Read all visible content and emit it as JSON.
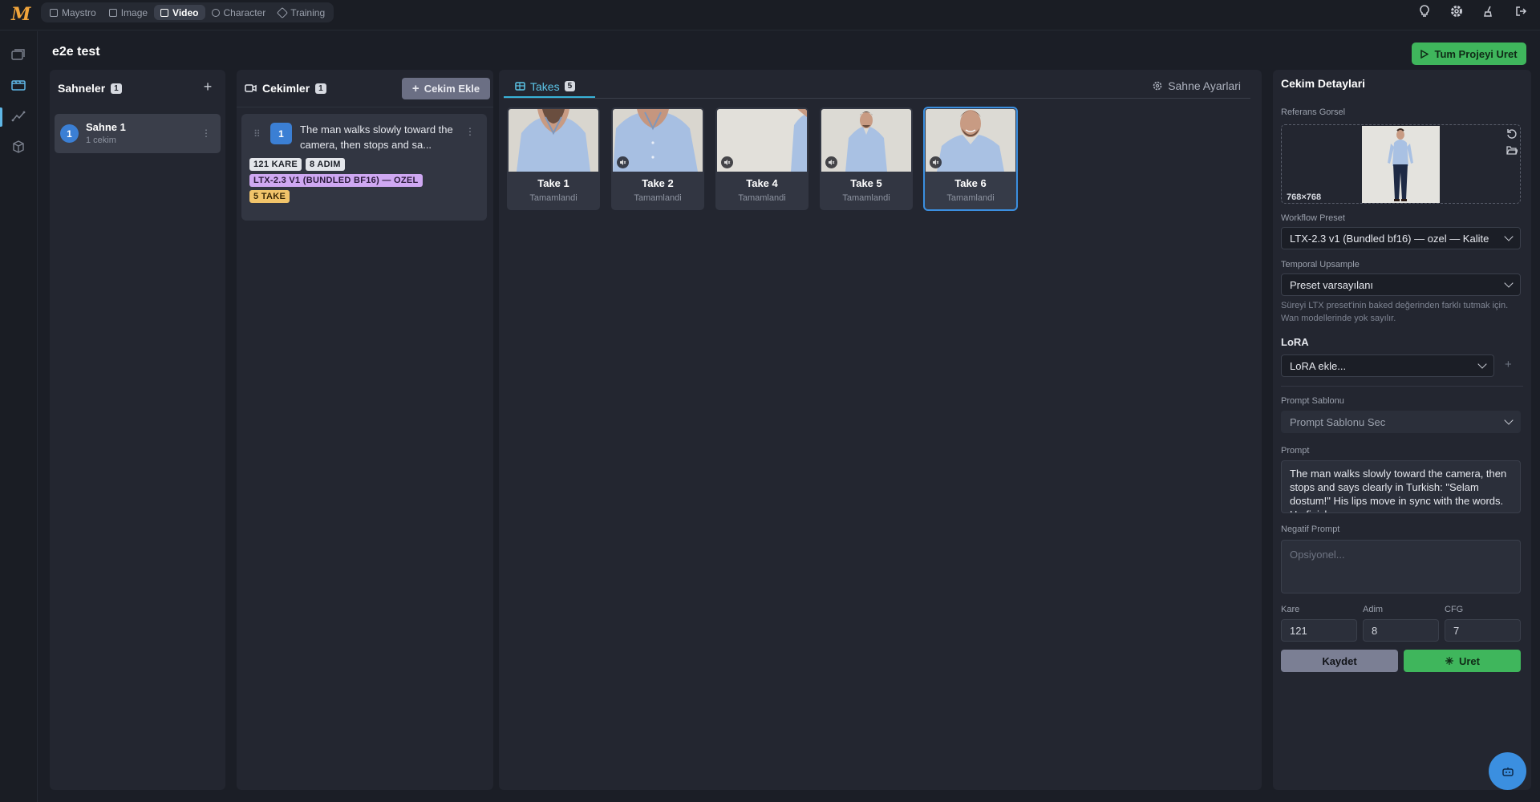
{
  "app": {
    "logo": "M",
    "nav": [
      {
        "label": "Maystro",
        "icon": "home-icon"
      },
      {
        "label": "Image",
        "icon": "image-icon"
      },
      {
        "label": "Video",
        "icon": "video-icon",
        "active": true
      },
      {
        "label": "Character",
        "icon": "character-icon"
      },
      {
        "label": "Training",
        "icon": "training-icon"
      }
    ],
    "top_icons": [
      "lightbulb-icon",
      "gear-icon",
      "broom-icon",
      "logout-icon"
    ],
    "rail_icons": [
      "gallery-icon",
      "film-icon",
      "graph-icon",
      "cube-icon"
    ],
    "accent": "#38b2d8",
    "success": "#3fb65c"
  },
  "project": {
    "title": "e2e test",
    "produce_all": "Tum Projeyi Uret"
  },
  "scenes": {
    "title": "Sahneler",
    "count": "1",
    "items": [
      {
        "number": "1",
        "name": "Sahne 1",
        "sub": "1 cekim"
      }
    ]
  },
  "shots": {
    "title": "Cekimler",
    "count": "1",
    "add_label": "Cekim Ekle",
    "items": [
      {
        "number": "1",
        "text": "The man walks slowly toward the camera, then stops and sa...",
        "tag_frames": "121 KARE",
        "tag_steps": "8 ADIM",
        "tag_model": "LTX-2.3 V1 (BUNDLED BF16) — OZEL",
        "tag_takes": "5 TAKE"
      }
    ]
  },
  "takes": {
    "tab_label": "Takes",
    "count": "5",
    "scene_settings": "Sahne Ayarlari",
    "items": [
      {
        "name": "Take 1",
        "status": "Tamamlandi",
        "muted": false
      },
      {
        "name": "Take 2",
        "status": "Tamamlandi",
        "muted": true
      },
      {
        "name": "Take 4",
        "status": "Tamamlandi",
        "muted": true
      },
      {
        "name": "Take 5",
        "status": "Tamamlandi",
        "muted": true
      },
      {
        "name": "Take 6",
        "status": "Tamamlandi",
        "muted": true,
        "selected": true
      }
    ]
  },
  "details": {
    "title": "Cekim Detaylari",
    "ref_label": "Referans Gorsel",
    "ref_size": "768×768",
    "workflow_label": "Workflow Preset",
    "workflow_value": "LTX-2.3 v1 (Bundled bf16) — ozel — Kalite",
    "temporal_label": "Temporal Upsample",
    "temporal_value": "Preset varsayılanı",
    "temporal_hint": "Süreyi LTX preset'inin baked değerinden farklı tutmak için. Wan modellerinde yok sayılır.",
    "lora_label": "LoRA",
    "lora_value": "LoRA ekle...",
    "prompt_template_label": "Prompt Sablonu",
    "prompt_template_value": "Prompt Sablonu Sec",
    "prompt_label": "Prompt",
    "prompt_value": "The man walks slowly toward the camera, then stops and says clearly in Turkish: \"Selam dostum!\" His lips move in sync with the words. He finish",
    "negative_label": "Negatif Prompt",
    "negative_placeholder": "Opsiyonel...",
    "frames_label": "Kare",
    "frames_value": "121",
    "steps_label": "Adim",
    "steps_value": "8",
    "cfg_label": "CFG",
    "cfg_value": "7",
    "save_label": "Kaydet",
    "generate_label": "Uret"
  }
}
